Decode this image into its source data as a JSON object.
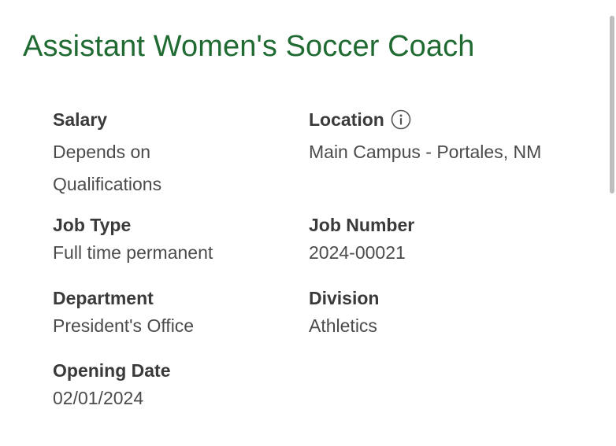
{
  "job": {
    "title": "Assistant Women's Soccer Coach"
  },
  "colors": {
    "title_green": "#1f6b31"
  },
  "details": {
    "salary": {
      "label": "Salary",
      "value": "Depends on Qualifications"
    },
    "location": {
      "label": "Location",
      "value": "Main Campus - Portales, NM",
      "icon": "info-icon"
    },
    "job_type": {
      "label": "Job Type",
      "value": "Full time permanent"
    },
    "job_number": {
      "label": "Job Number",
      "value": "2024-00021"
    },
    "department": {
      "label": "Department",
      "value": "President's Office"
    },
    "division": {
      "label": "Division",
      "value": "Athletics"
    },
    "opening_date": {
      "label": "Opening Date",
      "value": "02/01/2024"
    }
  }
}
